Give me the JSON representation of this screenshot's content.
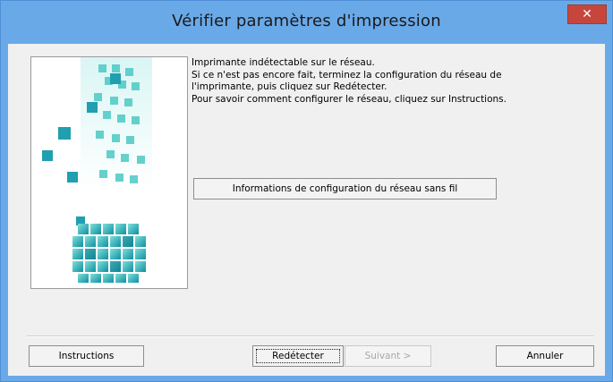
{
  "window": {
    "title": "Vérifier paramètres d'impression",
    "close_symbol": "✕"
  },
  "message": {
    "line1": "Imprimante indétectable sur le réseau.",
    "line2": "Si ce n'est pas encore fait, terminez la configuration du réseau de",
    "line3": "l'imprimante, puis cliquez sur Redétecter.",
    "line4": "Pour savoir comment configurer le réseau, cliquez sur Instructions."
  },
  "buttons": {
    "wifi_info": "Informations de configuration du réseau sans fil",
    "instructions": "Instructions",
    "redetect": "Redétecter",
    "next": "Suivant >",
    "cancel": "Annuler"
  },
  "icons": {
    "illustration": "printer-network-cubes-illustration",
    "close": "close-icon"
  },
  "colors": {
    "title_bar": "#6aa9e8",
    "close_button": "#c7463b",
    "dialog_background": "#f0f0f0",
    "illustration_accent": "#2ab6b6"
  }
}
